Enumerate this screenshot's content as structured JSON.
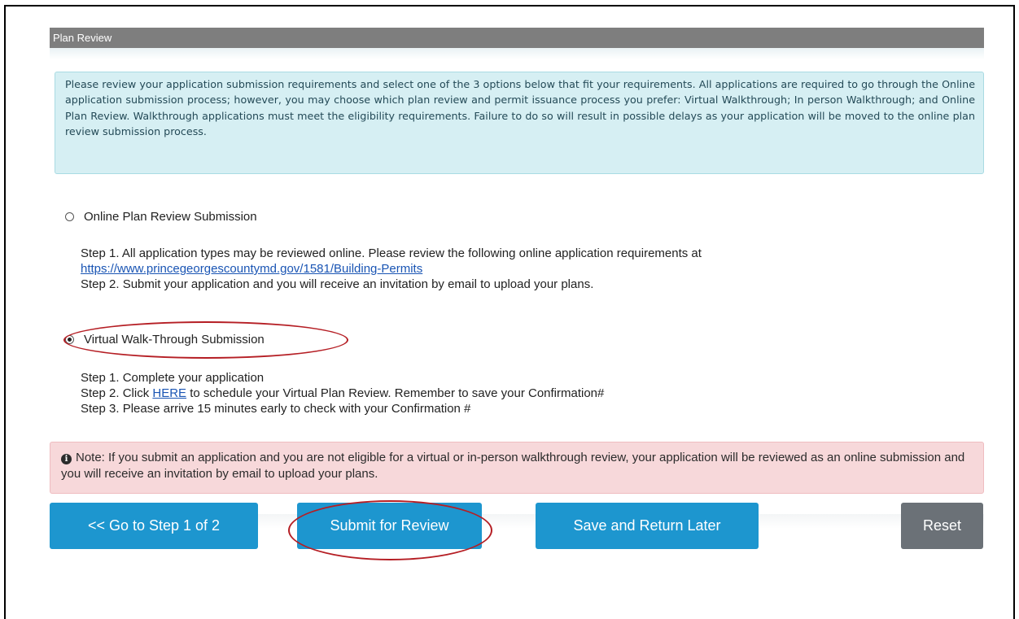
{
  "panel": {
    "title": "Plan Review"
  },
  "info": {
    "text": "Please review your application submission requirements and select one of the 3 options below that fit your requirements. All applications are required to go through the Online application submission process; however, you may choose which plan review and permit issuance process you prefer: Virtual Walkthrough; In person Walkthrough; and Online Plan Review. Walkthrough applications must meet the eligibility requirements. Failure to do so will result in possible delays as your application will be moved to the online plan review submission process."
  },
  "options": [
    {
      "label": "Online Plan Review Submission",
      "selected": false,
      "steps": {
        "step1_text": "Step 1. All application types may be reviewed online. Please review the following online application requirements at",
        "step1_link": "https://www.princegeorgescountymd.gov/1581/Building-Permits",
        "step2_text": "Step 2. Submit your application and you will receive an invitation by email to upload your plans."
      }
    },
    {
      "label": "Virtual Walk-Through Submission",
      "selected": true,
      "steps": {
        "step1_text": "Step 1. Complete your application",
        "step2_before": "Step 2. Click ",
        "step2_link": "HERE",
        "step2_after": " to schedule your Virtual Plan Review. Remember to save your Confirmation#",
        "step3_text": "Step 3. Please arrive 15 minutes early to check with your Confirmation #"
      }
    }
  ],
  "note": {
    "icon": "info-circle-icon",
    "text": "Note:  If you submit an application and you are not eligible for a virtual or in-person walkthrough review, your application will be reviewed as an online submission and you will receive an invitation by email to upload your plans."
  },
  "buttons": {
    "back": "<<  Go to Step 1 of 2",
    "submit": "Submit for Review",
    "save": "Save and Return Later",
    "reset": "Reset"
  },
  "colors": {
    "header_bg": "#7e7e7e",
    "info_bg": "#d6eff3",
    "note_bg": "#f7d8da",
    "primary_button": "#1d96cf",
    "reset_button": "#6b7177",
    "highlight": "#b51e24",
    "link": "#1a55b4"
  }
}
